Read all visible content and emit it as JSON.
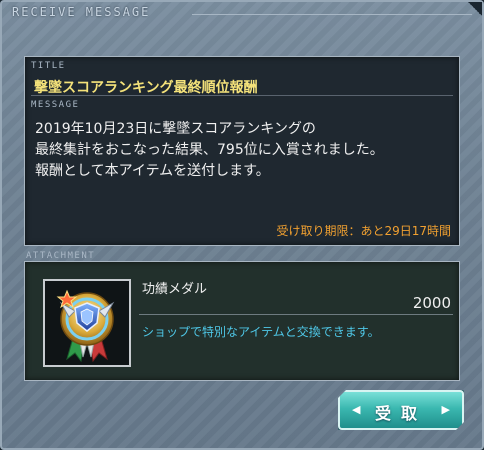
{
  "window": {
    "title": "RECEIVE MESSAGE"
  },
  "message_panel": {
    "title_label": "TITLE",
    "title": "撃墜スコアランキング最終順位報酬",
    "message_label": "MESSAGE",
    "body": "2019年10月23日に撃墜スコアランキングの\n最終集計をおこなった結果、795位に入賞されました。\n報酬として本アイテムを送付します。",
    "deadline": "受け取り期限：あと29日17時間"
  },
  "attachment": {
    "label": "ATTACHMENT",
    "item_icon": "medal-icon",
    "item_name": "功績メダル",
    "item_count": "2000",
    "item_description": "ショップで特別なアイテムと交換できます。"
  },
  "actions": {
    "receive_label": "受取"
  },
  "colors": {
    "title": "#f4e27a",
    "deadline": "#f0a030",
    "description": "#4fc8e8",
    "button": "#3bb8b0"
  }
}
